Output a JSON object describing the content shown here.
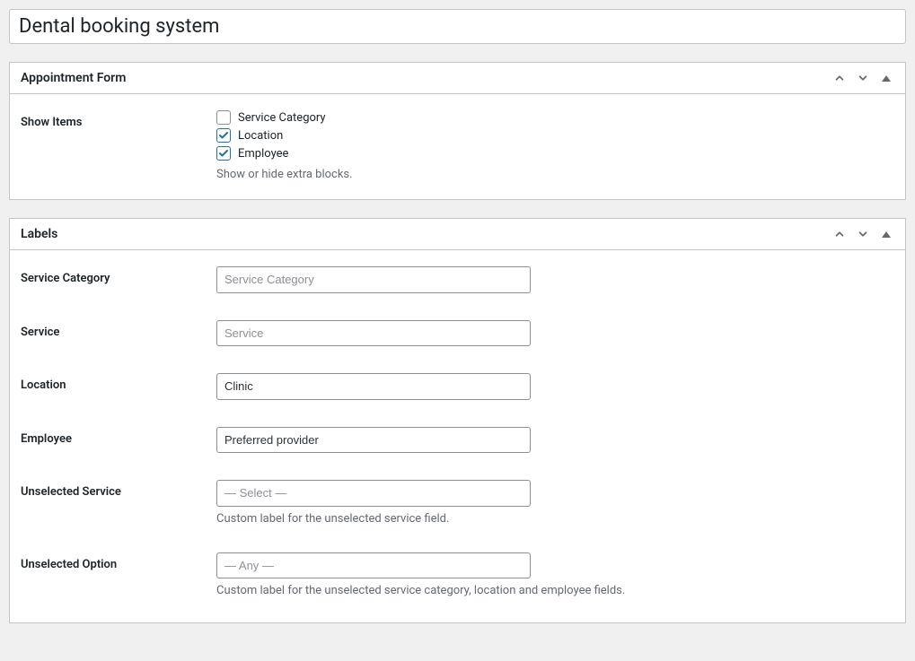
{
  "page": {
    "title": "Dental booking system"
  },
  "panels": {
    "appointment_form": {
      "title": "Appointment Form",
      "show_items": {
        "label": "Show Items",
        "options": {
          "service_category": {
            "label": "Service Category",
            "checked": false
          },
          "location": {
            "label": "Location",
            "checked": true
          },
          "employee": {
            "label": "Employee",
            "checked": true
          }
        },
        "help": "Show or hide extra blocks."
      }
    },
    "labels": {
      "title": "Labels",
      "fields": {
        "service_category": {
          "label": "Service Category",
          "value": "",
          "placeholder": "Service Category"
        },
        "service": {
          "label": "Service",
          "value": "",
          "placeholder": "Service"
        },
        "location": {
          "label": "Location",
          "value": "Clinic",
          "placeholder": ""
        },
        "employee": {
          "label": "Employee",
          "value": "Preferred provider",
          "placeholder": ""
        },
        "unselected_service": {
          "label": "Unselected Service",
          "value": "",
          "placeholder": "— Select —",
          "help": "Custom label for the unselected service field."
        },
        "unselected_option": {
          "label": "Unselected Option",
          "value": "",
          "placeholder": "— Any —",
          "help": "Custom label for the unselected service category, location and employee fields."
        }
      }
    }
  }
}
